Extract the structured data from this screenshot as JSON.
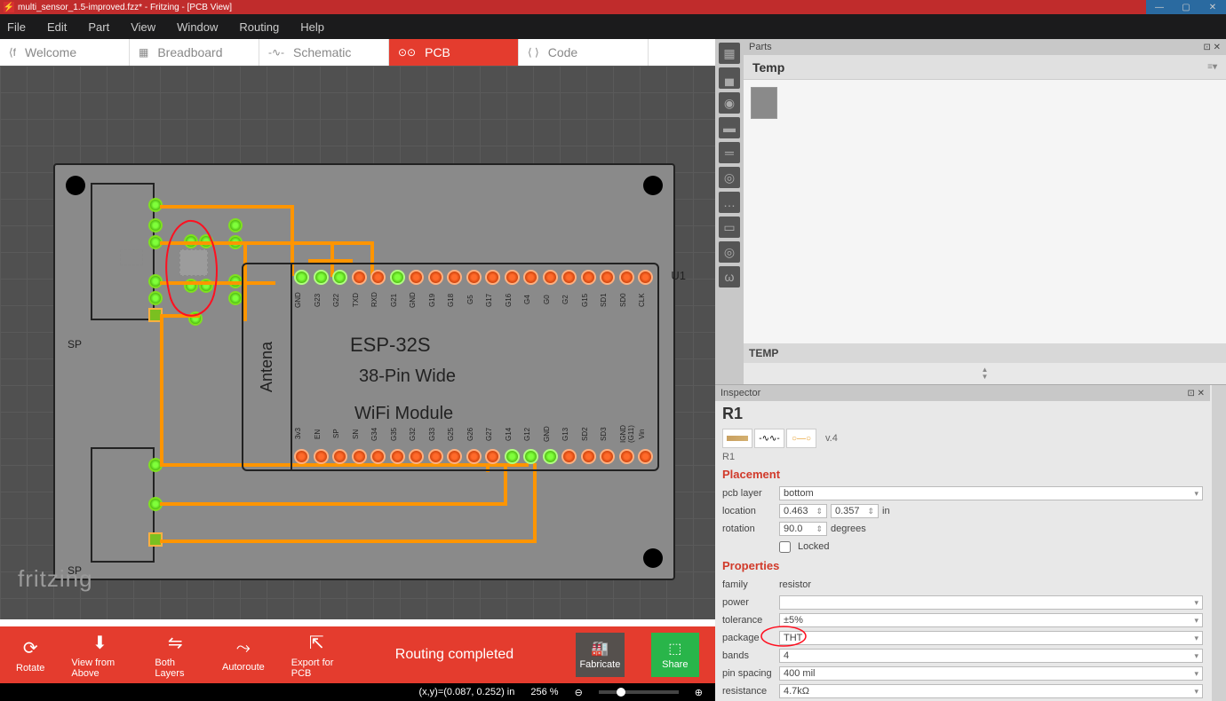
{
  "titlebar": "multi_sensor_1.5-improved.fzz* - Fritzing - [PCB View]",
  "menu": {
    "file": "File",
    "edit": "Edit",
    "part": "Part",
    "view": "View",
    "window": "Window",
    "routing": "Routing",
    "help": "Help"
  },
  "tabs": {
    "welcome": "Welcome",
    "breadboard": "Breadboard",
    "schematic": "Schematic",
    "pcb": "PCB",
    "code": "Code"
  },
  "board": {
    "title": "ESP-32S",
    "subtitle1": "38-Pin Wide",
    "subtitle2": "WiFi Module",
    "antena": "Antena",
    "ref": "U1",
    "sp": "SP",
    "sp2": "SP",
    "top_pins": [
      "GND",
      "G23",
      "G22",
      "TXD",
      "RXD",
      "G21",
      "GND",
      "G19",
      "G18",
      "G5",
      "G17",
      "G16",
      "G4",
      "G0",
      "G2",
      "G15",
      "SD1",
      "SD0",
      "CLK"
    ],
    "bot_pins": [
      "3v3",
      "EN",
      "SP",
      "SN",
      "G34",
      "G35",
      "G32",
      "G33",
      "G25",
      "G26",
      "G27",
      "G14",
      "G12",
      "GND",
      "G13",
      "SD2",
      "SD3",
      "IGND (G11)",
      "Vin"
    ]
  },
  "logo": "fritzing",
  "footer": {
    "rotate": "Rotate",
    "viewabove": "View from Above",
    "both": "Both Layers",
    "auto": "Autoroute",
    "export": "Export for PCB",
    "routing": "Routing completed",
    "fab": "Fabricate",
    "share": "Share"
  },
  "status": {
    "coords": "(x,y)=(0.087, 0.252) in",
    "zoom": "256 %"
  },
  "parts": {
    "header": "Parts",
    "temp": "Temp",
    "templabel": "TEMP"
  },
  "inspector": {
    "header": "Inspector",
    "name": "R1",
    "version": "v.4",
    "shortname": "R1",
    "placement": {
      "hdr": "Placement",
      "layer_lbl": "pcb layer",
      "layer_val": "bottom",
      "loc_lbl": "location",
      "loc_x": "0.463",
      "loc_y": "0.357",
      "loc_unit": "in",
      "rot_lbl": "rotation",
      "rot_val": "90.0",
      "rot_unit": "degrees",
      "locked": "Locked"
    },
    "properties": {
      "hdr": "Properties",
      "family_lbl": "family",
      "family_val": "resistor",
      "power_lbl": "power",
      "power_val": "",
      "tol_lbl": "tolerance",
      "tol_val": "±5%",
      "pkg_lbl": "package",
      "pkg_val": "THT",
      "bands_lbl": "bands",
      "bands_val": "4",
      "spacing_lbl": "pin spacing",
      "spacing_val": "400 mil",
      "res_lbl": "resistance",
      "res_val": "4.7kΩ"
    }
  }
}
